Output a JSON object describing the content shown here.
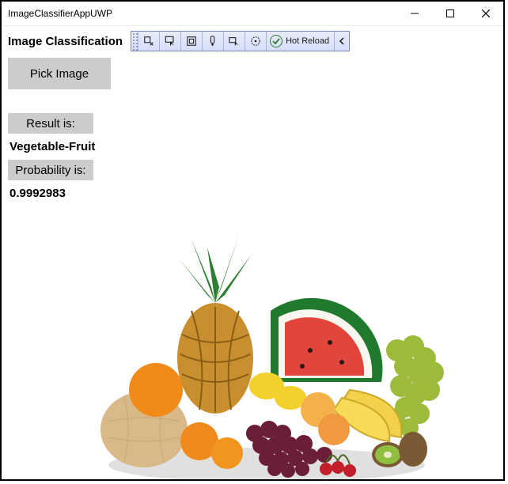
{
  "window": {
    "title": "ImageClassifierAppUWP"
  },
  "header": {
    "title": "Image Classification"
  },
  "debug_toolbar": {
    "hot_reload_label": "Hot Reload"
  },
  "controls": {
    "pick_button_label": "Pick Image",
    "result_label": "Result is:",
    "result_value": "Vegetable-Fruit",
    "probability_label": "Probability is:",
    "probability_value": "0.9992983"
  }
}
